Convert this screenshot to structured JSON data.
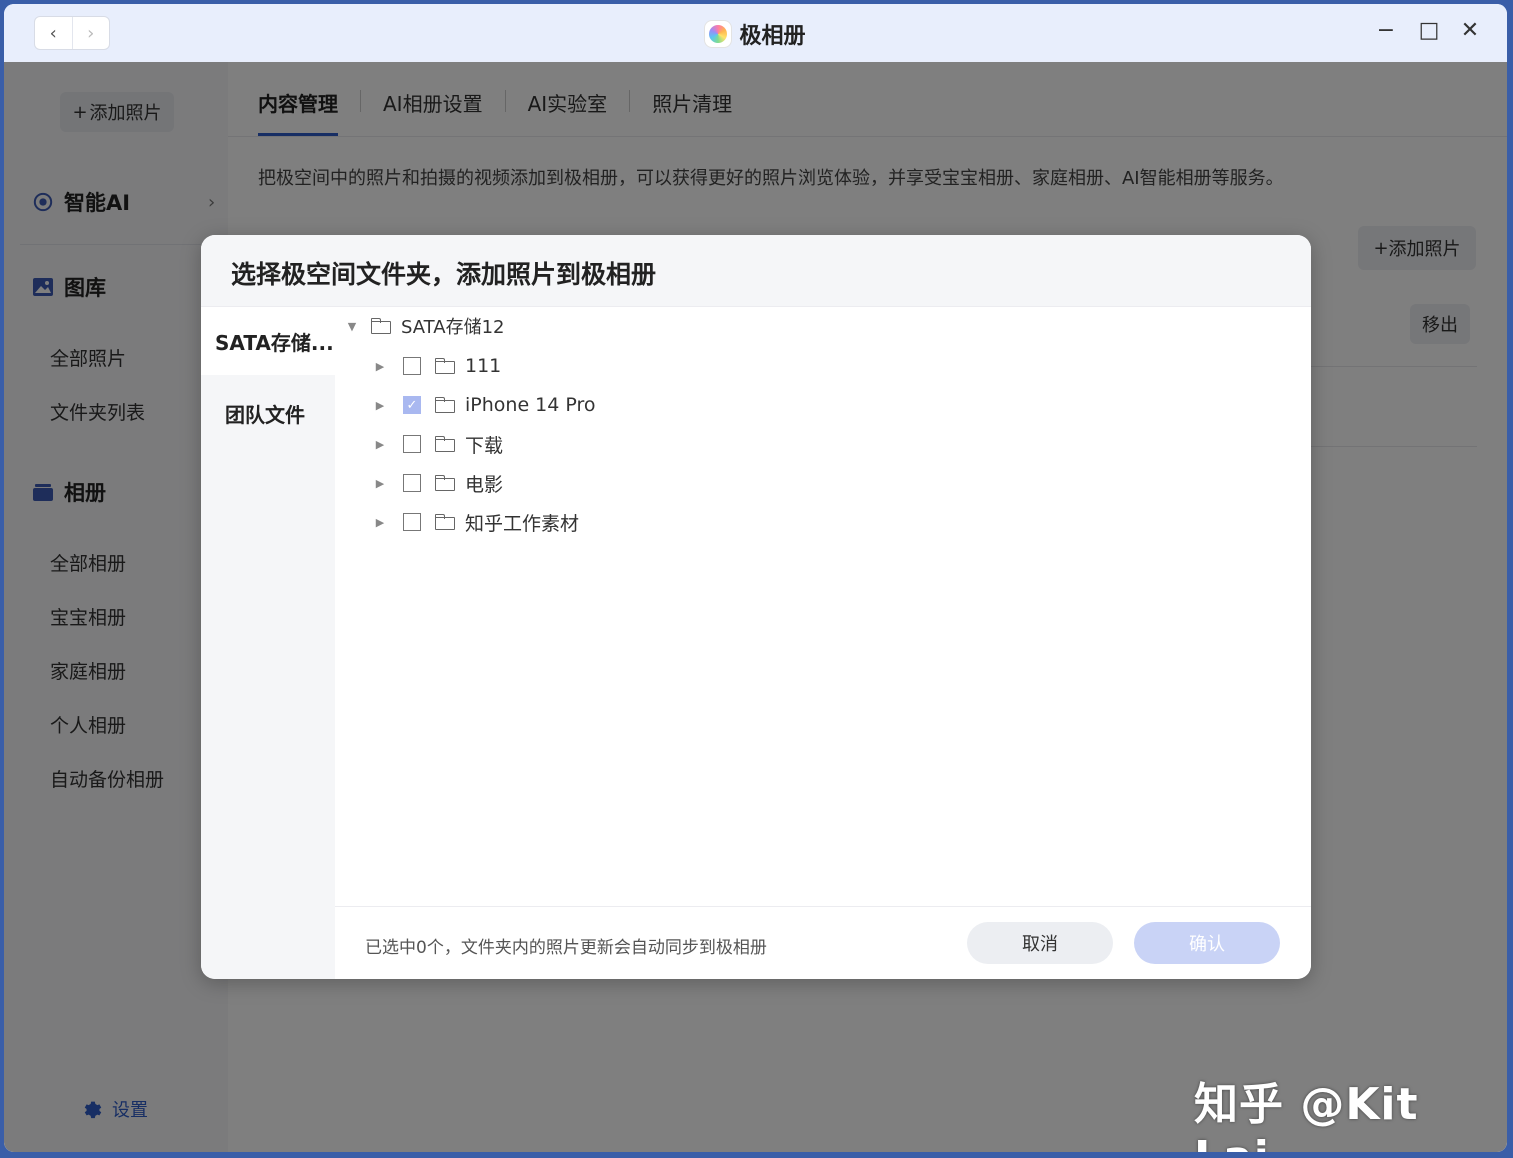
{
  "window": {
    "title": "极相册",
    "nav_back": "‹",
    "nav_forward": "›",
    "minimize": "−",
    "maximize": "□",
    "close": "✕"
  },
  "sidebar": {
    "add_photos": "添加照片",
    "smart_ai": "智能AI",
    "gallery": "图库",
    "all_photos": "全部照片",
    "folder_list": "文件夹列表",
    "albums": "相册",
    "album_items": [
      "全部相册",
      "宝宝相册",
      "家庭相册",
      "个人相册",
      "自动备份相册"
    ],
    "settings": "设置"
  },
  "main": {
    "tabs": [
      "内容管理",
      "AI相册设置",
      "AI实验室",
      "照片清理"
    ],
    "description": "把极空间中的照片和拍摄的视频添加到极相册，可以获得更好的照片浏览体验，并享受宝宝相册、家庭相册、AI智能相册等服务。",
    "add_photos": "添加照片",
    "remove": "移出"
  },
  "modal": {
    "title": "选择极空间文件夹，添加照片到极相册",
    "sources": [
      "SATA存储...",
      "团队文件"
    ],
    "root_folder": "SATA存储12",
    "folders": [
      {
        "name": "111",
        "checked": false
      },
      {
        "name": "iPhone 14 Pro",
        "checked": true
      },
      {
        "name": "下载",
        "checked": false
      },
      {
        "name": "电影",
        "checked": false
      },
      {
        "name": "知乎工作素材",
        "checked": false
      }
    ],
    "footer_text": "已选中0个，文件夹内的照片更新会自动同步到极相册",
    "cancel": "取消",
    "confirm": "确认"
  },
  "watermark": "知乎 @Kit Lai",
  "colors": {
    "accent": "#2f5dc8",
    "confirm_disabled": "#c9d3f6",
    "checkbox_checked": "#a9b8f0",
    "overlay": "rgba(0,0,0,0.5)"
  }
}
